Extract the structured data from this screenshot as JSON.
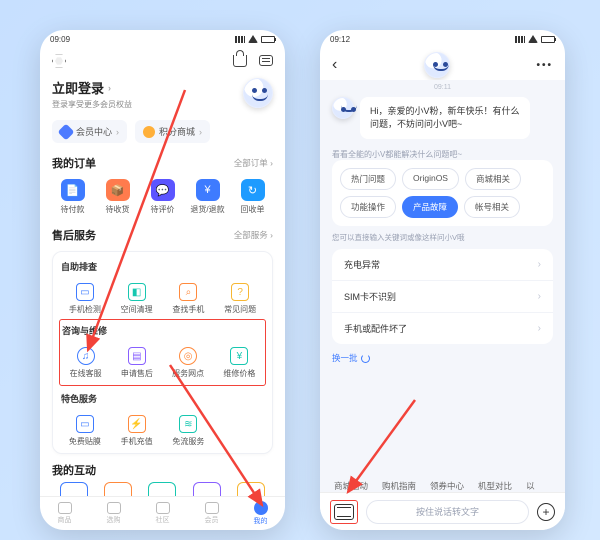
{
  "left": {
    "status_time": "09:09",
    "login": {
      "title": "立即登录",
      "sub": "登录享受更多会员权益"
    },
    "chips": {
      "member": "会员中心",
      "points": "积分商城"
    },
    "orders": {
      "title": "我的订单",
      "more": "全部订单",
      "items": [
        {
          "label": "待付款"
        },
        {
          "label": "待收货"
        },
        {
          "label": "待评价"
        },
        {
          "label": "退货/退款"
        },
        {
          "label": "回收单"
        }
      ]
    },
    "service": {
      "title": "售后服务",
      "more": "全部服务",
      "group1": {
        "head": "自助排查",
        "items": [
          {
            "label": "手机检测"
          },
          {
            "label": "空间清理"
          },
          {
            "label": "查找手机"
          },
          {
            "label": "常见问题"
          }
        ]
      },
      "group2": {
        "head": "咨询与维修",
        "items": [
          {
            "label": "在线客服"
          },
          {
            "label": "申请售后"
          },
          {
            "label": "服务网点"
          },
          {
            "label": "维修价格"
          }
        ]
      },
      "group3": {
        "head": "特色服务",
        "items": [
          {
            "label": "免费贴膜"
          },
          {
            "label": "手机充值"
          },
          {
            "label": "免流服务"
          }
        ]
      }
    },
    "interact_title": "我的互动",
    "tabs": [
      {
        "label": "商品"
      },
      {
        "label": "选购"
      },
      {
        "label": "社区"
      },
      {
        "label": "会员"
      },
      {
        "label": "我的"
      }
    ]
  },
  "right": {
    "status_time": "09:12",
    "timestamp": "09:11",
    "greeting": "Hi，亲爱的小V粉，新年快乐！有什么问题，不妨问问小V吧~",
    "ask_line": "看看全能的小V都能解决什么问题吧~",
    "pills": [
      "热门问题",
      "OriginOS",
      "商城相关",
      "功能操作",
      "产品故障",
      "帐号相关"
    ],
    "pill_active_index": 4,
    "hint": "您可以直接输入关键词或像这样问小V哦",
    "list": [
      "充电异常",
      "SIM卡不识别",
      "手机或配件坏了"
    ],
    "refresh": "换一批",
    "suggestions": [
      "商城活动",
      "购机指南",
      "领券中心",
      "机型对比",
      "以"
    ],
    "input_placeholder": "按住说话转文字"
  }
}
